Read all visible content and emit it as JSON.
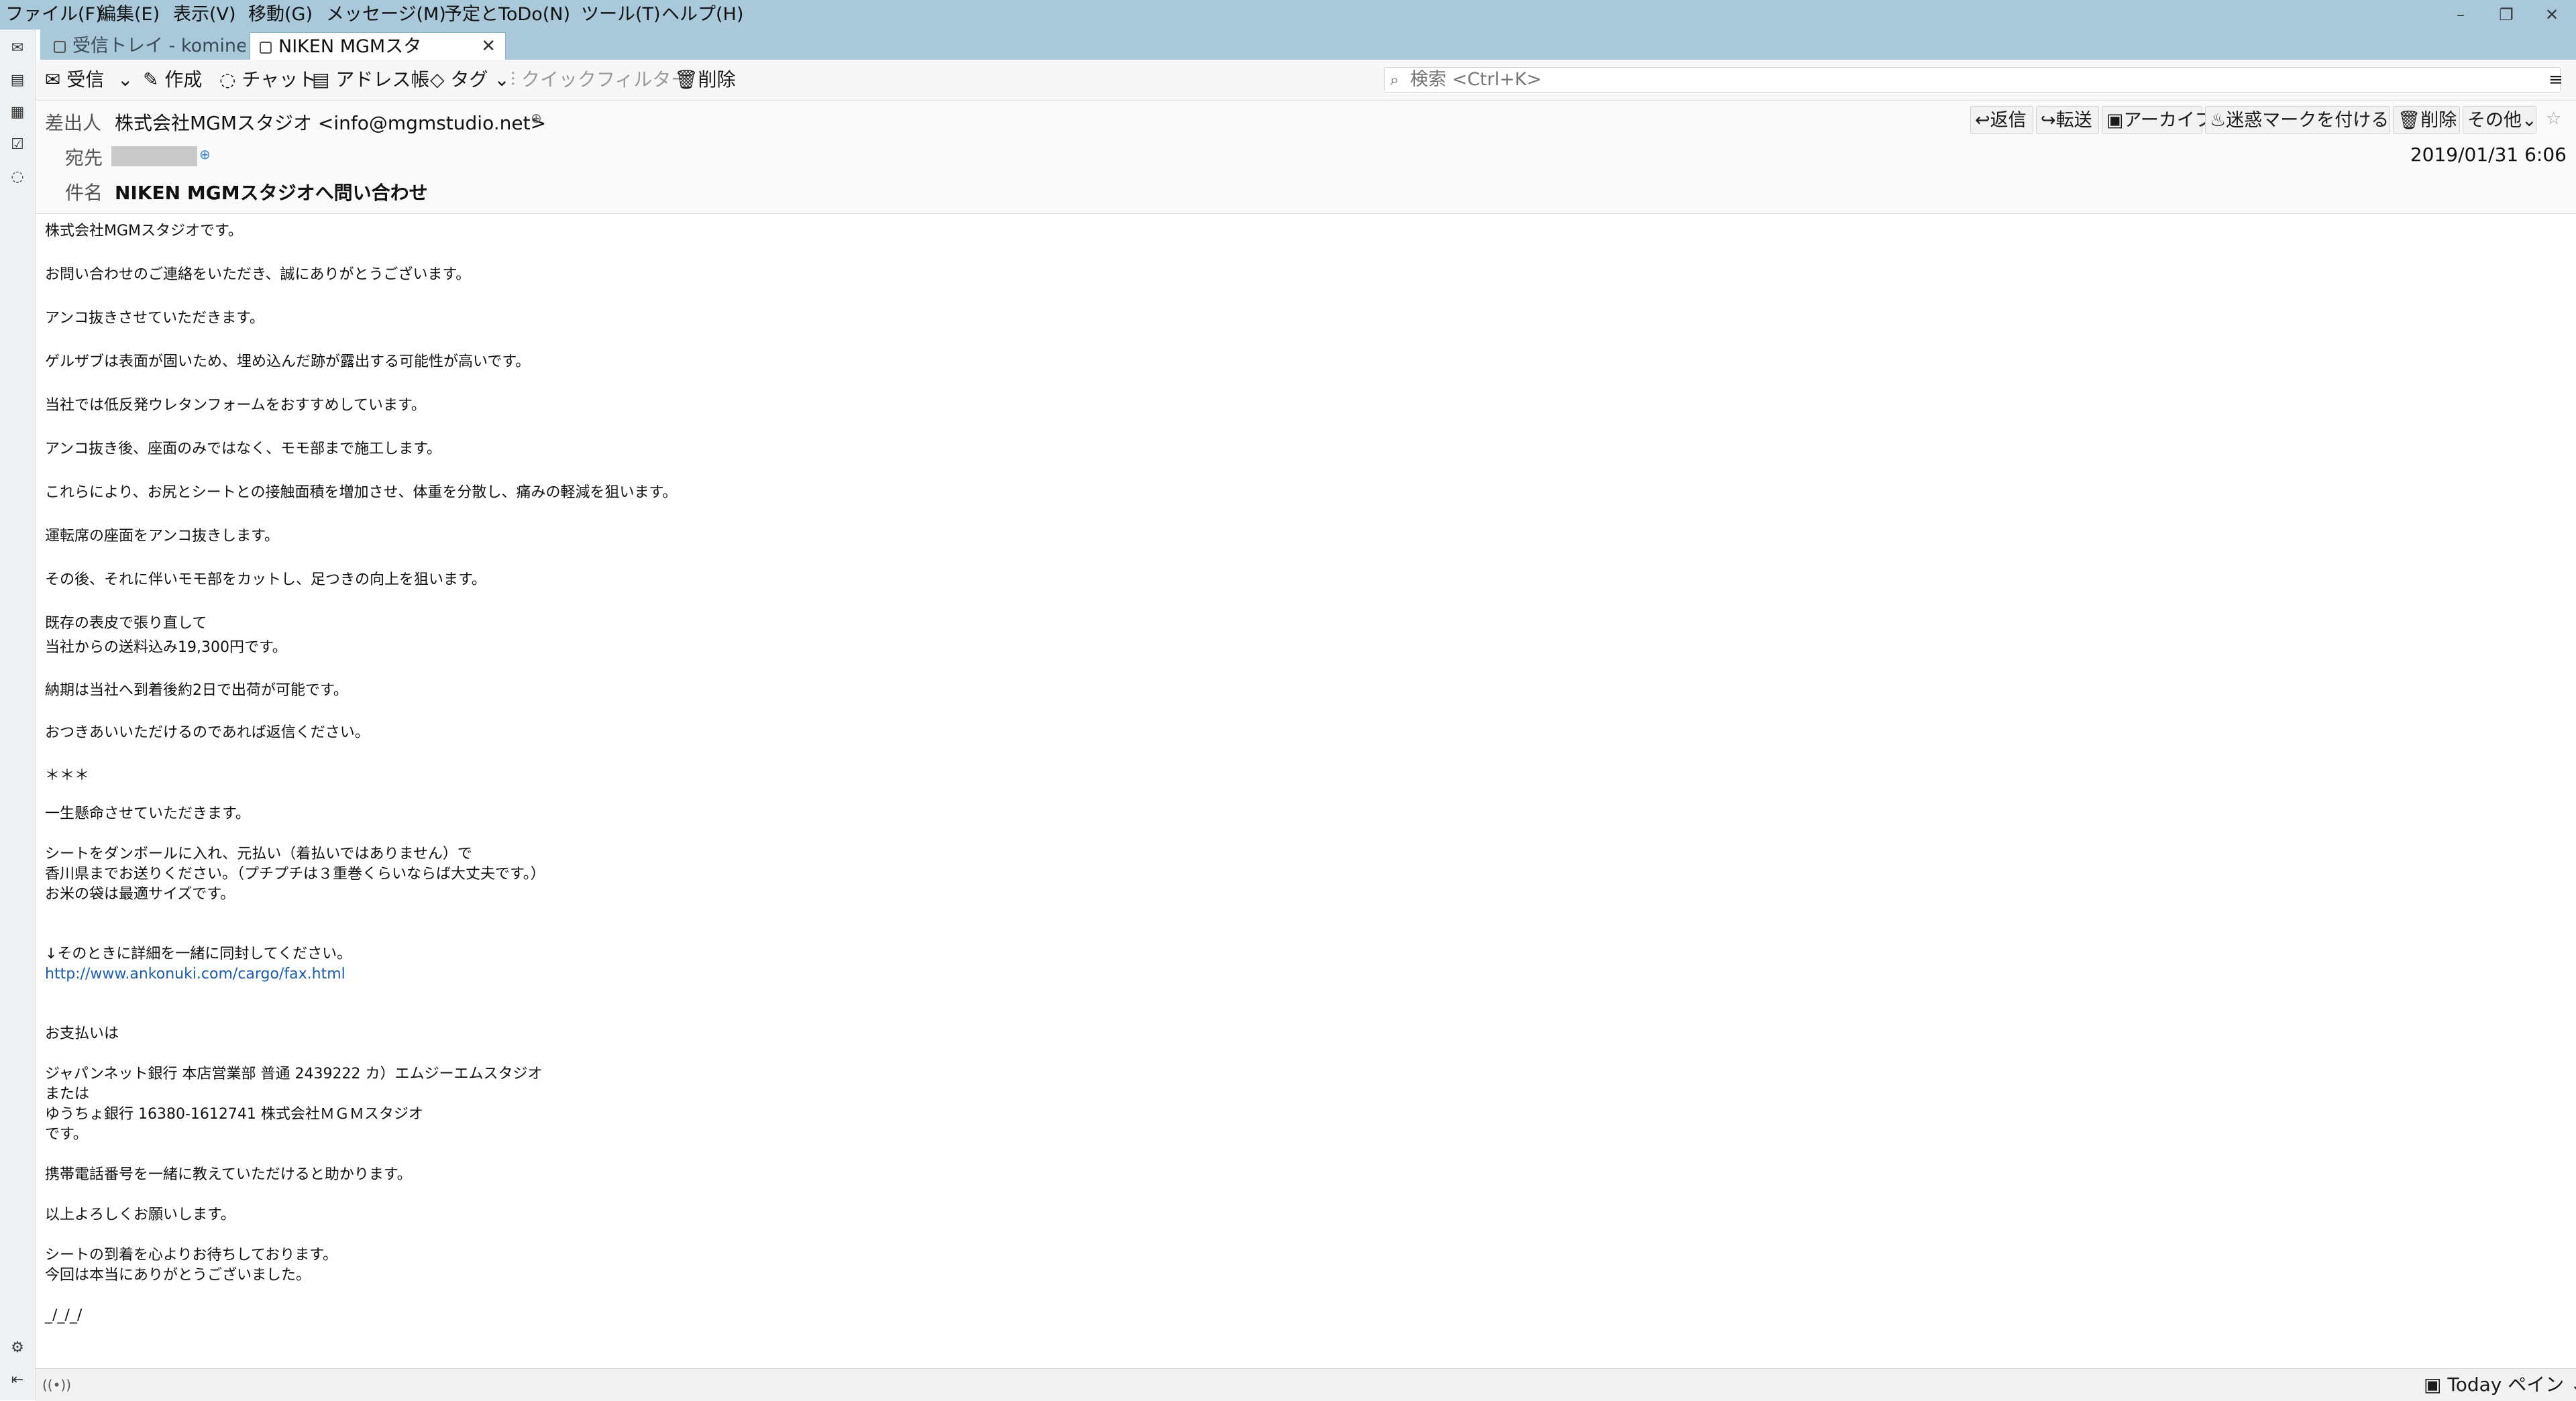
{
  "menubar": {
    "items": [
      "ファイル(F)",
      "編集(E)",
      "表示(V)",
      "移動(G)",
      "メッセージ(M)",
      "予定とToDo(N)",
      "ツール(T)",
      "ヘルプ(H)"
    ],
    "minimize_glyph": "–",
    "restore_glyph": "❐",
    "close_glyph": "✕"
  },
  "tabs": [
    {
      "label": "受信トレイ - komine"
    },
    {
      "label": "NIKEN MGMスタ",
      "close": "✕"
    }
  ],
  "toolbar": {
    "get_mail": "受信",
    "write": "作成",
    "chat": "チャット",
    "address_book": "アドレス帳",
    "tag": "タグ",
    "quick_filter": "クイックフィルター",
    "delete": "削除",
    "search_placeholder": "検索 <Ctrl+K>"
  },
  "header": {
    "from_label": "差出人",
    "from_value": "株式会社MGMスタジオ <info@mgmstudio.net>",
    "to_label": "宛先",
    "subject_label": "件名",
    "subject_value": "NIKEN MGMスタジオへ問い合わせ",
    "date": "2019/01/31 6:06",
    "buttons": {
      "reply": "返信",
      "forward": "転送",
      "archive": "アーカイブ",
      "junk": "迷惑マークを付ける",
      "delete": "削除",
      "other": "その他"
    }
  },
  "body_lines": [
    "株式会社MGMスタジオです。",
    "お問い合わせのご連絡をいただき、誠にありがとうございます。",
    "アンコ抜きさせていただきます。",
    "ゲルザブは表面が固いため、埋め込んだ跡が露出する可能性が高いです。",
    "当社では低反発ウレタンフォームをおすすめしています。",
    "アンコ抜き後、座面のみではなく、モモ部まで施工します。",
    "これらにより、お尻とシートとの接触面積を増加させ、体重を分散し、痛みの軽減を狙います。",
    "運転席の座面をアンコ抜きします。",
    "その後、それに伴いモモ部をカットし、足つきの向上を狙います。",
    "既存の表皮で張り直して",
    "当社からの送料込み19,300円です。",
    "納期は当社へ到着後約2日で出荷が可能です。",
    "おつきあいいただけるのであれば返信ください。",
    "＊＊＊",
    "一生懸命させていただきます。",
    "シートをダンボールに入れ、元払い（着払いではありません）で",
    "香川県までお送りください。（プチプチは３重巻くらいならば大丈夫です。）",
    "お米の袋は最適サイズです。",
    "↓そのときに詳細を一緒に同封してください。",
    "http://www.ankonuki.com/cargo/fax.html",
    "お支払いは",
    "ジャパンネット銀行 本店営業部 普通 2439222 カ）エムジーエムスタジオ",
    "または",
    "ゆうちょ銀行 16380-1612741 株式会社ＭＧＭスタジオ",
    "です。",
    "携帯電話番号を一緒に教えていただけると助かります。",
    "以上よろしくお願いします。",
    "シートの到着を心よりお待ちしております。",
    "今回は本当にありがとうございました。",
    "_/_/_/"
  ],
  "statusbar": {
    "today_pane": "Today ペイン"
  },
  "colors": {
    "menubar_bg": "#a9c8da",
    "link": "#1c5dab"
  }
}
